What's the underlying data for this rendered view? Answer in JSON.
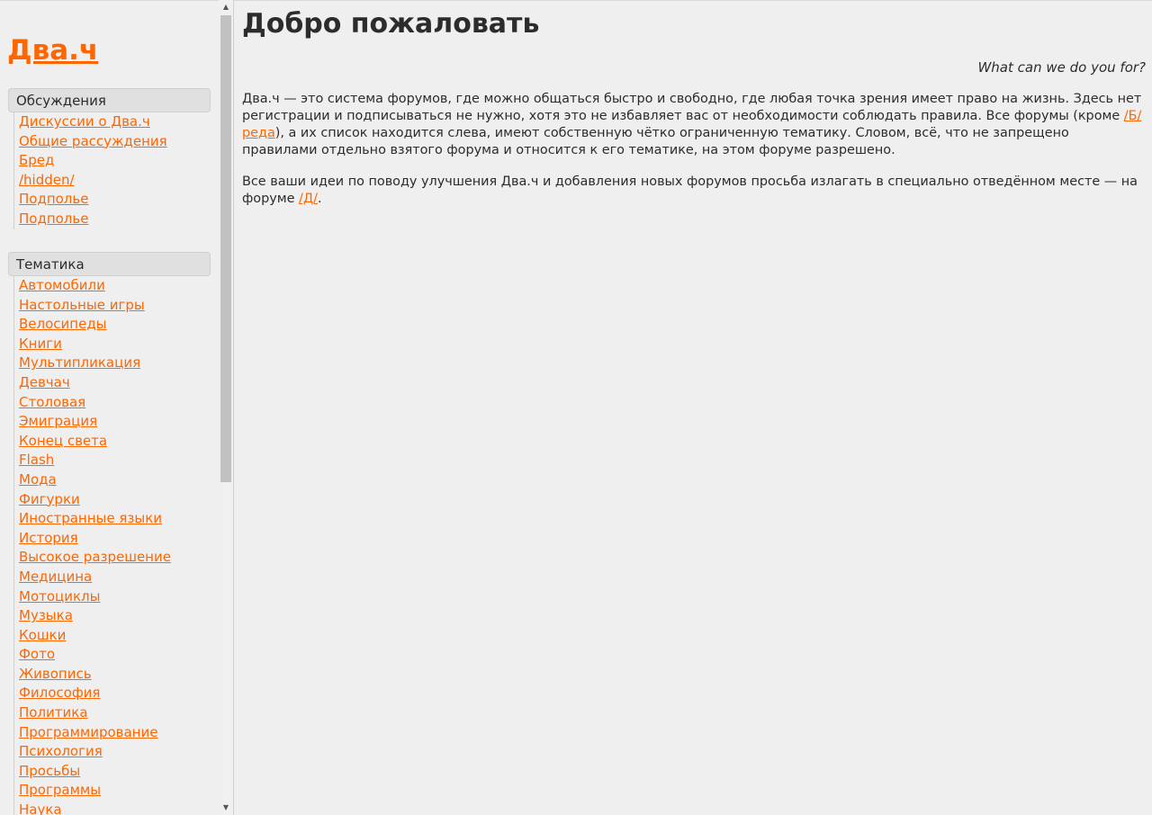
{
  "site": {
    "logo": "Два.ч"
  },
  "sidebar": {
    "sections": [
      {
        "title": "Обсуждения",
        "items": [
          "Дискуссии о Два.ч",
          "Общие рассуждения",
          "Бред",
          "/hidden/",
          "Подполье",
          "Подполье"
        ]
      },
      {
        "title": "Тематика",
        "items": [
          "Автомобили",
          "Настольные игры",
          "Велосипеды",
          "Книги",
          "Мультипликация",
          "Девчач",
          "Столовая",
          "Эмиграция",
          "Конец света",
          "Flash",
          "Мода",
          "Фигурки",
          "Иностранные языки",
          "История",
          "Высокое разрешение",
          "Медицина",
          "Мотоциклы",
          "Музыка",
          "Кошки",
          "Фото",
          "Живопись",
          "Философия",
          "Политика",
          "Программирование",
          "Психология",
          "Просьбы",
          "Программы",
          "Наука"
        ]
      }
    ]
  },
  "main": {
    "title": "Добро пожаловать",
    "tagline": "What can we do you for?",
    "para1": {
      "text_a": "Два.ч — это система форумов, где можно общаться быстро и свободно, где любая точка зрения имеет право на жизнь. Здесь нет регистрации и подписываться не нужно, хотя это не избавляет вас от необходимости соблюдать правила. Все форумы (кроме ",
      "link": "/Б/реда",
      "text_b": "), а их список находится слева, имеют собственную чётко ограниченную тематику. Словом, всё, что не запрещено правилами отдельно взятого форума и относится к его тематике, на этом форуме разрешено."
    },
    "para2": {
      "text_a": "Все ваши идеи по поводу улучшения Два.ч и добавления новых форумов просьба излагать в специально отведённом месте — на форуме ",
      "link": "/Д/",
      "text_b": "."
    }
  },
  "scrollbar": {
    "up_icon": "arrow-up-icon",
    "down_icon": "arrow-down-icon"
  },
  "colors": {
    "link": "#ff6600",
    "background": "#efefef",
    "header_bg": "#e0e0e0"
  }
}
